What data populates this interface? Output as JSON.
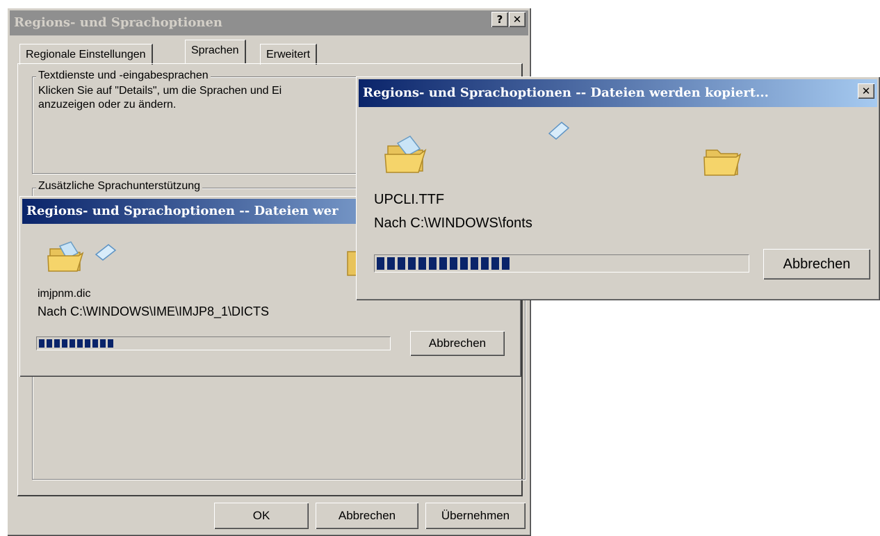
{
  "main_dialog": {
    "title": "Regions- und Sprachoptionen",
    "help_button": "?",
    "close_button": "✕",
    "tabs": [
      "Regionale Einstellungen",
      "Sprachen",
      "Erweitert"
    ],
    "selected_tab": "Sprachen",
    "group1": {
      "legend": "Textdienste und -eingabesprachen",
      "text_line1": "Klicken Sie auf \"Details\", um die Sprachen und Ei",
      "text_line2": "anzuzeigen oder zu ändern."
    },
    "group2": {
      "legend": "Zusätzliche Sprachunterstützung"
    },
    "buttons": {
      "ok": "OK",
      "cancel": "Abbrechen",
      "apply": "Übernehmen"
    }
  },
  "copy_dialog_1": {
    "title": "Regions- und Sprachoptionen -- Dateien wer",
    "file": "imjpnm.dic",
    "destination": "Nach C:\\WINDOWS\\IME\\IMJP8_1\\DICTS",
    "progress_percent": 22,
    "cancel": "Abbrechen"
  },
  "copy_dialog_2": {
    "title": "Regions- und Sprachoptionen -- Dateien werden kopiert...",
    "close_button": "✕",
    "file": "UPCLI.TTF",
    "destination": "Nach C:\\WINDOWS\\fonts",
    "progress_percent": 39,
    "cancel": "Abbrechen"
  },
  "icons": {
    "source_folder": "open-folder-icon",
    "flying_file": "flying-document-icon",
    "target_folder": "open-folder-icon"
  },
  "colors": {
    "face": "#d4d0c8",
    "active_title": "#0a246a",
    "progress": "#0a246a"
  }
}
